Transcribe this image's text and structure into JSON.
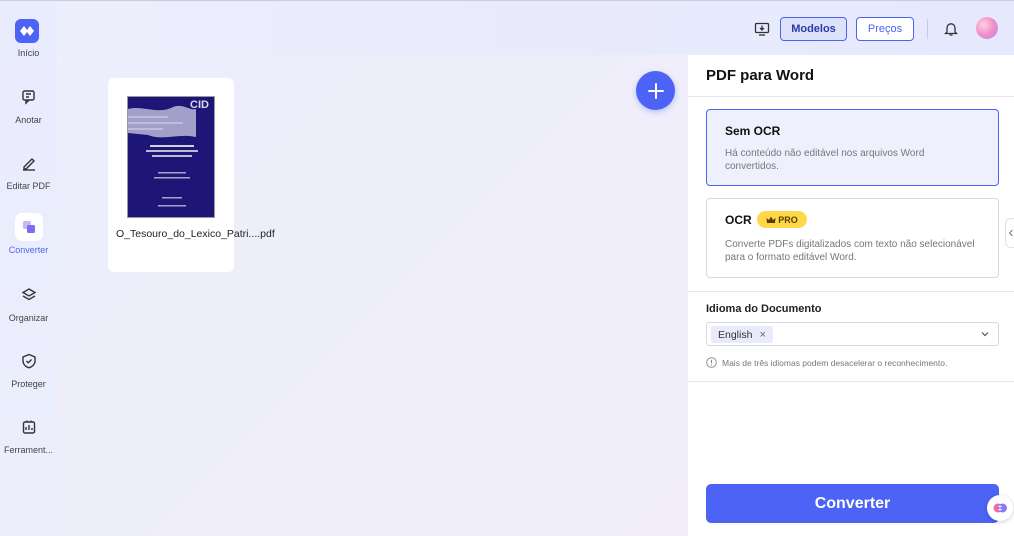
{
  "sidebar": {
    "logo_label": "Início",
    "items": [
      {
        "label": "Anotar",
        "icon": "annotate-icon"
      },
      {
        "label": "Editar PDF",
        "icon": "edit-pen-icon"
      },
      {
        "label": "Converter",
        "icon": "convert-icon",
        "active": true
      },
      {
        "label": "Organizar",
        "icon": "layers-icon"
      },
      {
        "label": "Proteger",
        "icon": "shield-icon"
      },
      {
        "label": "Ferrament...",
        "icon": "tools-icon"
      }
    ]
  },
  "topbar": {
    "modelos_label": "Modelos",
    "precos_label": "Preços",
    "icons": [
      "download-desktop-icon",
      "bell-icon",
      "avatar"
    ]
  },
  "workspace": {
    "file": {
      "name": "O_Tesouro_do_Lexico_Patri....pdf",
      "thumb_text": "CID"
    },
    "add_icon": "plus-icon"
  },
  "panel": {
    "title": "PDF para Word",
    "options": [
      {
        "title": "Sem OCR",
        "desc": "Há conteúdo não editável nos arquivos Word convertidos.",
        "selected": true
      },
      {
        "title": "OCR",
        "badge": "PRO",
        "desc": "Converte PDFs digitalizados com texto não selecionável para o formato editável Word.",
        "selected": false
      }
    ],
    "language_label": "Idioma do Documento",
    "language_chip": "English",
    "language_chip_remove": "×",
    "hint": "Mais de três idiomas podem desacelerar o reconhecimento.",
    "convert_label": "Converter"
  },
  "colors": {
    "accent": "#4d63f5",
    "pro_badge": "#ffd84a",
    "thumb_bg": "#1e1676"
  }
}
